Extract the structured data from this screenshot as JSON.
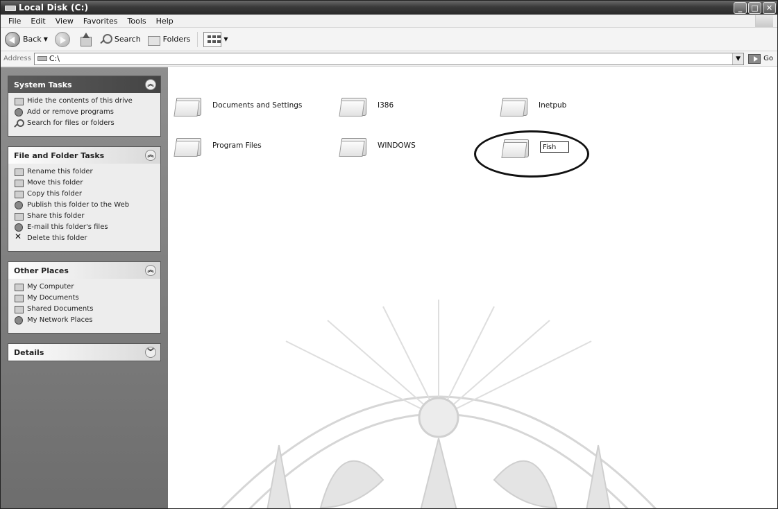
{
  "window": {
    "title": "Local Disk (C:)"
  },
  "menu": [
    "File",
    "Edit",
    "View",
    "Favorites",
    "Tools",
    "Help"
  ],
  "toolbar": {
    "back_label": "Back",
    "search_label": "Search",
    "folders_label": "Folders"
  },
  "address": {
    "label": "Address",
    "value": "C:\\",
    "go_label": "Go"
  },
  "system_tasks": {
    "title": "System Tasks",
    "items": [
      "Hide the contents of this drive",
      "Add or remove programs",
      "Search for files or folders"
    ]
  },
  "file_folder_tasks": {
    "title": "File and Folder Tasks",
    "items": [
      "Rename this folder",
      "Move this folder",
      "Copy this folder",
      "Publish this folder to the Web",
      "Share this folder",
      "E-mail this folder's files",
      "Delete this folder"
    ]
  },
  "other_places": {
    "title": "Other Places",
    "items": [
      "My Computer",
      "My Documents",
      "Shared Documents",
      "My Network Places"
    ]
  },
  "details": {
    "title": "Details"
  },
  "folders": [
    {
      "name": "Documents and Settings"
    },
    {
      "name": "I386"
    },
    {
      "name": "Inetpub"
    },
    {
      "name": "Program Files"
    },
    {
      "name": "WINDOWS"
    }
  ],
  "rename": {
    "value": "Fish"
  }
}
